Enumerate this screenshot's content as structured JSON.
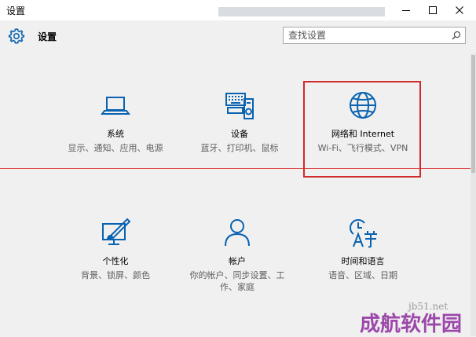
{
  "window": {
    "title": "设置"
  },
  "header": {
    "title": "设置"
  },
  "search": {
    "placeholder": "查找设置"
  },
  "tiles": [
    {
      "name": "系统",
      "desc": "显示、通知、应用、电源",
      "icon": "laptop-icon"
    },
    {
      "name": "设备",
      "desc": "蓝牙、打印机、鼠标",
      "icon": "devices-icon"
    },
    {
      "name": "网络和 Internet",
      "desc": "Wi-Fi、飞行模式、VPN",
      "icon": "globe-icon"
    },
    {
      "name": "个性化",
      "desc": "背景、锁屏、颜色",
      "icon": "personalization-icon"
    },
    {
      "name": "帐户",
      "desc": "你的帐户、同步设置、工作、家庭",
      "icon": "person-icon"
    },
    {
      "name": "时间和语言",
      "desc": "语音、区域、日期",
      "icon": "time-language-icon"
    }
  ],
  "watermark": {
    "site": "jb51.net",
    "text": "成航软件园"
  },
  "colors": {
    "accent": "#0a63b0",
    "highlight": "#d12a2a",
    "background": "#f0f0f0"
  }
}
